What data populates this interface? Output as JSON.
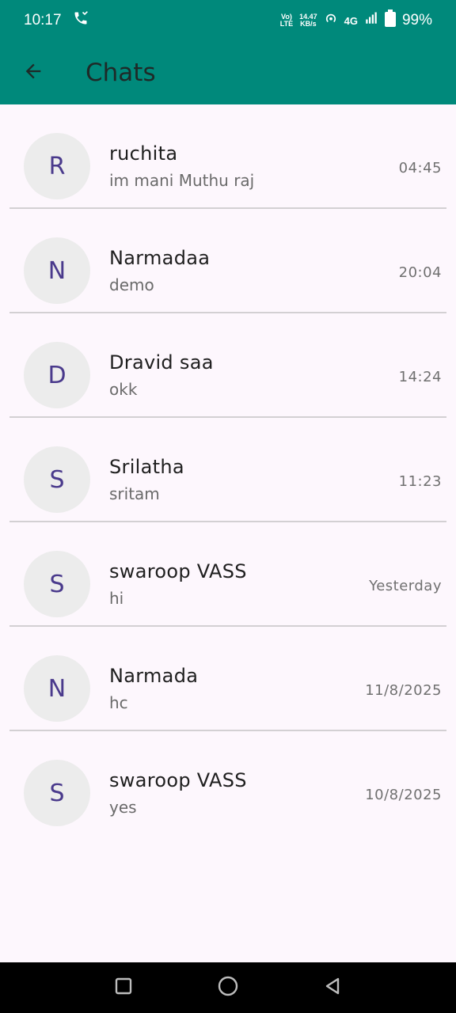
{
  "status_bar": {
    "time": "10:17",
    "volte_top": "Vo)",
    "volte_bottom": "LTE",
    "speed_top": "14.47",
    "speed_bottom": "KB/s",
    "network": "4G",
    "battery": "99%"
  },
  "app_bar": {
    "title": "Chats"
  },
  "chats": [
    {
      "initial": "R",
      "name": "ruchita",
      "message": "im mani Muthu raj",
      "time": "04:45"
    },
    {
      "initial": "N",
      "name": "Narmadaa",
      "message": "demo",
      "time": "20:04"
    },
    {
      "initial": "D",
      "name": "Dravid saa",
      "message": "okk",
      "time": "14:24"
    },
    {
      "initial": "S",
      "name": "Srilatha",
      "message": "sritam",
      "time": "11:23"
    },
    {
      "initial": "S",
      "name": "swaroop VASS",
      "message": "hi",
      "time": "Yesterday"
    },
    {
      "initial": "N",
      "name": "Narmada",
      "message": "hc",
      "time": "11/8/2025"
    },
    {
      "initial": "S",
      "name": "swaroop VASS",
      "message": "yes",
      "time": "10/8/2025"
    }
  ],
  "colors": {
    "app_bar": "#00897b",
    "background": "#fdf7fd",
    "avatar_bg": "#ececec",
    "avatar_text": "#4a3a8c"
  },
  "icons": {
    "call": "phone-call-icon",
    "back": "arrow-left-icon",
    "nav_recents": "square-icon",
    "nav_home": "circle-icon",
    "nav_back": "triangle-back-icon"
  }
}
